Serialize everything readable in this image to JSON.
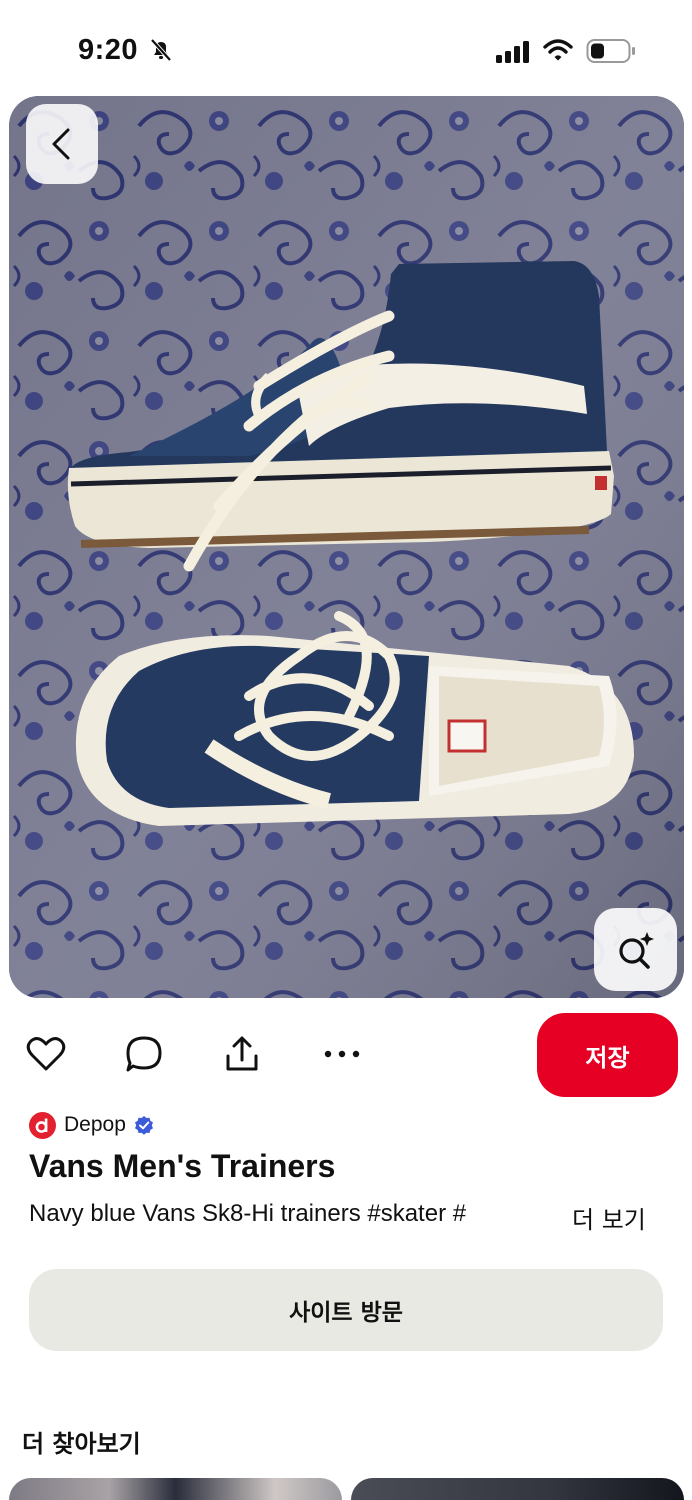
{
  "status_bar": {
    "time": "9:20"
  },
  "hero": {
    "icons": {
      "back": "chevron-left-icon",
      "visual_search": "lens-sparkle-icon"
    }
  },
  "actions": {
    "icons": [
      "heart-icon",
      "comment-icon",
      "share-icon",
      "more-icon"
    ],
    "save_label": "저장",
    "colors": {
      "save": "#e60023"
    }
  },
  "pin": {
    "source_name": "Depop",
    "source_color": "#e3202d",
    "title": "Vans Men's Trainers",
    "description": "Navy blue Vans Sk8-Hi trainers #skater #",
    "more_label": "더 보기"
  },
  "visit_label": "사이트 방문",
  "explore": {
    "heading": "더 찾아보기"
  }
}
